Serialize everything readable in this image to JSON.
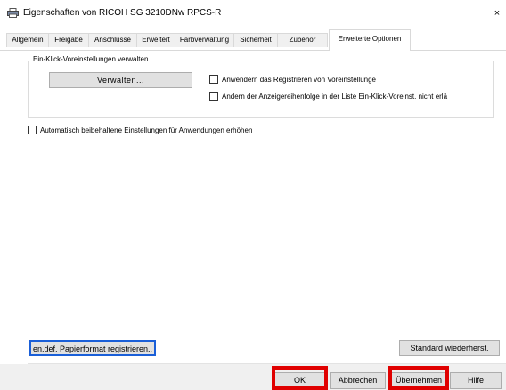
{
  "window": {
    "title": "Eigenschaften von RICOH SG 3210DNw RPCS-R",
    "close_label": "×",
    "icon": "printer-icon"
  },
  "tabs": [
    {
      "label": "Allgemein",
      "active": false
    },
    {
      "label": "Freigabe",
      "active": false
    },
    {
      "label": "Anschlüsse",
      "active": false
    },
    {
      "label": "Erweitert",
      "active": false
    },
    {
      "label": "Farbverwaltung",
      "active": false
    },
    {
      "label": "Sicherheit",
      "active": false
    },
    {
      "label": "Zubehör",
      "active": false
    },
    {
      "label": "Erweiterte Optionen",
      "active": true
    }
  ],
  "one_click_group": {
    "title": "Ein-Klick-Voreinstellungen verwalten",
    "manage_button": "Verwalten...",
    "allow_register_checkbox": {
      "label": "Anwendern das Registrieren von Voreinstellunge",
      "checked": false
    },
    "change_order_checkbox": {
      "label": "Ändern der Anzeigereihenfolge in der Liste Ein-Klick-Voreinst. nicht erlä",
      "checked": false
    }
  },
  "auto_increase_checkbox": {
    "label": "Automatisch beibehaltene Einstellungen für Anwendungen erhöhen",
    "checked": false
  },
  "bottom_buttons": {
    "register_paper": "en.def. Papierformat registrieren..",
    "restore_default": "Standard wiederherst."
  },
  "dialog_buttons": {
    "ok": "OK",
    "cancel": "Abbrechen",
    "apply": "Übernehmen",
    "help": "Hilfe"
  },
  "colors": {
    "highlight": "#e00000",
    "focus_border": "#1a5fd8",
    "button_face": "#e1e1e1",
    "footer_bg": "#f0f0f0"
  }
}
